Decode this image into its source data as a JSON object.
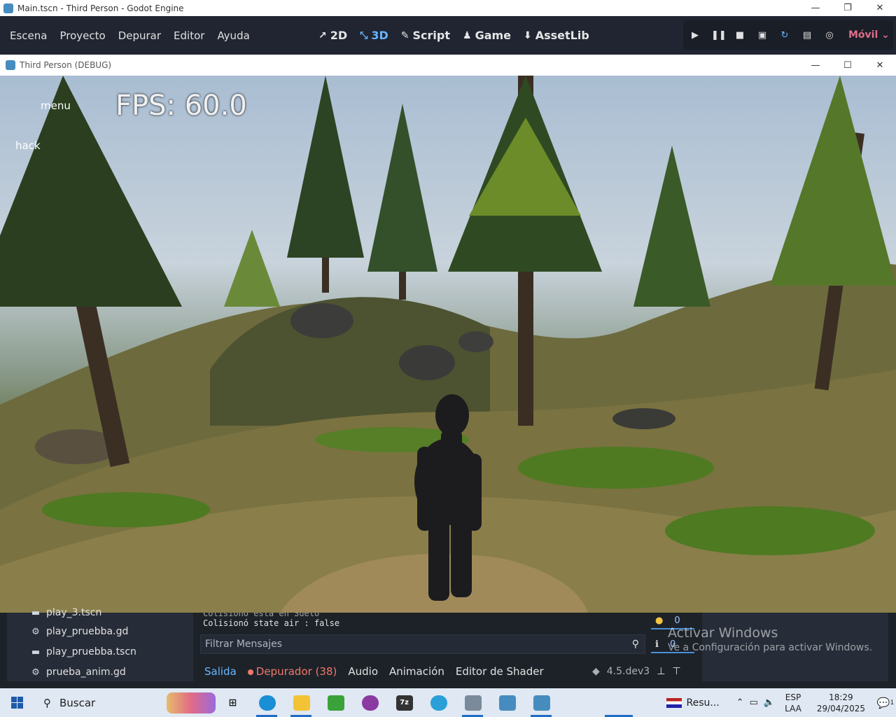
{
  "outer_window": {
    "title": "Main.tscn - Third Person - Godot Engine"
  },
  "editor": {
    "menus": [
      "Escena",
      "Proyecto",
      "Depurar",
      "Editor",
      "Ayuda"
    ],
    "workspaces": [
      {
        "label": "2D",
        "icon": "2d-icon"
      },
      {
        "label": "3D",
        "icon": "3d-icon",
        "active": true
      },
      {
        "label": "Script",
        "icon": "script-icon"
      },
      {
        "label": "Game",
        "icon": "game-icon"
      },
      {
        "label": "AssetLib",
        "icon": "assetlib-icon"
      }
    ],
    "renderer": "Móvil"
  },
  "game_window": {
    "title": "Third Person (DEBUG)",
    "hud": {
      "menu": "menu",
      "hack": "hack",
      "fps": "FPS: 60.0"
    }
  },
  "filesystem": {
    "items": [
      {
        "name": "play_3.tscn",
        "icon": "scene-icon"
      },
      {
        "name": "play_pruebba.gd",
        "icon": "gear-icon"
      },
      {
        "name": "play_pruebba.tscn",
        "icon": "scene-icon"
      },
      {
        "name": "prueba_anim.gd",
        "icon": "gear-icon"
      }
    ]
  },
  "output": {
    "cut_line": "Colisionó está en Suelo",
    "last_line": "Colisionó state air : false",
    "filter_placeholder": "Filtrar Mensajes",
    "warning_count": "0",
    "info_count": "0"
  },
  "bottom_tabs": {
    "salida": "Salida",
    "depurador": "Depurador (38)",
    "audio": "Audio",
    "animacion": "Animación",
    "shader": "Editor de Shader",
    "version": "4.5.dev3"
  },
  "watermark": {
    "line1": "Activar Windows",
    "line2": "Ve a Configuración para activar Windows."
  },
  "taskbar": {
    "search_label": "Buscar",
    "news": "Resu...",
    "lang_top": "ESP",
    "lang_bottom": "LAA",
    "time": "18:29",
    "date": "29/04/2025",
    "notifications": "1"
  }
}
